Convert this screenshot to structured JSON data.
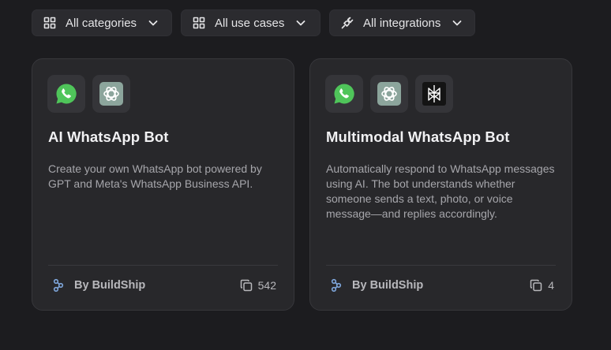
{
  "filters": {
    "categories_label": "All categories",
    "use_cases_label": "All use cases",
    "integrations_label": "All integrations"
  },
  "cards": [
    {
      "title": "AI WhatsApp Bot",
      "description": "Create your own WhatsApp bot powered by GPT and Meta's WhatsApp Business API.",
      "author": "By BuildShip",
      "count": "542",
      "icons": [
        "whatsapp-icon",
        "openai-icon"
      ]
    },
    {
      "title": "Multimodal WhatsApp Bot",
      "description": "Automatically respond to WhatsApp messages using AI. The bot understands whether someone sends a text, photo, or voice message—and replies accordingly.",
      "author": "By BuildShip",
      "count": "4",
      "icons": [
        "whatsapp-icon",
        "openai-icon",
        "perplexity-icon"
      ]
    }
  ],
  "colors": {
    "background": "#1c1c1f",
    "card": "#28282b",
    "whatsapp_green": "#4fc55a",
    "openai_tile": "#8ca59c",
    "buildship_blue": "#7fa7dc"
  }
}
